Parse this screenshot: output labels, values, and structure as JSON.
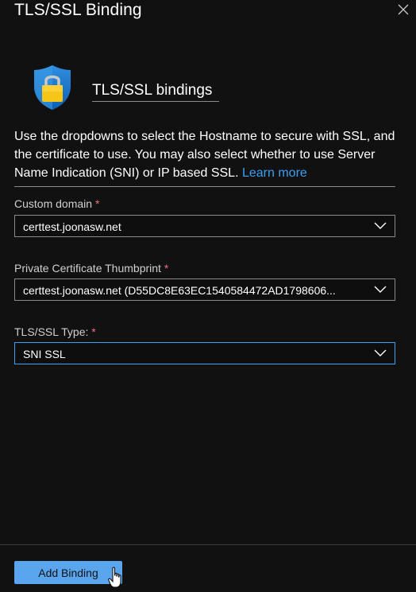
{
  "window": {
    "title": "TLS/SSL Binding",
    "close_icon": "close-icon"
  },
  "section": {
    "icon": "shield-lock-icon",
    "title": "TLS/SSL bindings"
  },
  "description": {
    "text": "Use the dropdowns to select the Hostname to secure with SSL, and the certificate to use. You may also select whether to use Server Name Indication (SNI) or IP based SSL.",
    "link": "Learn more"
  },
  "fields": {
    "custom_domain": {
      "label": "Custom domain",
      "required_mark": "*",
      "value": "certtest.joonasw.net"
    },
    "thumbprint": {
      "label": "Private Certificate Thumbprint",
      "required_mark": "*",
      "value": "certtest.joonasw.net (D55DC8E63EC1540584472AD1798606..."
    },
    "ssl_type": {
      "label": "TLS/SSL Type:",
      "required_mark": "*",
      "value": "SNI SSL"
    }
  },
  "footer": {
    "add_button": "Add Binding"
  },
  "colors": {
    "background": "#111111",
    "accent": "#59a6ef",
    "link": "#3aa0f3",
    "required": "#f1707b"
  }
}
